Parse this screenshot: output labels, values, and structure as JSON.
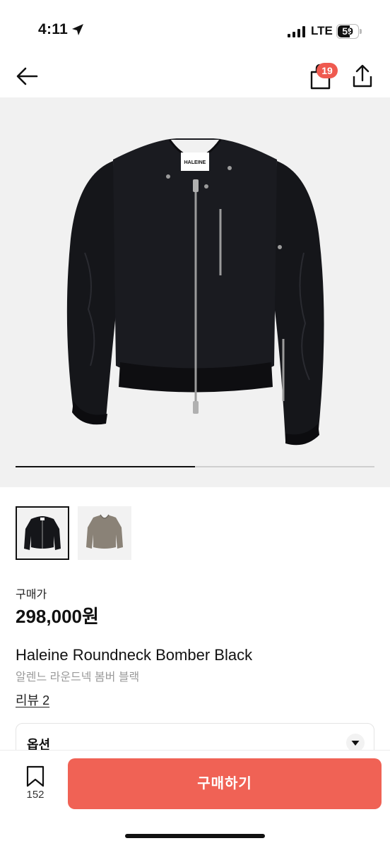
{
  "status_bar": {
    "time": "4:11",
    "network": "LTE",
    "battery": "59",
    "icons": [
      "location-arrow-icon",
      "signal-icon",
      "battery-icon"
    ]
  },
  "header": {
    "back_icon": "arrow-left-icon",
    "bag_icon": "shopping-bag-icon",
    "bag_badge": "19",
    "share_icon": "share-icon"
  },
  "gallery": {
    "images": [
      {
        "color": "black",
        "selected": true
      },
      {
        "color": "khaki",
        "selected": false
      }
    ],
    "progress": 0.5,
    "label_on_tag": "HALEINE"
  },
  "product": {
    "price_label": "구매가",
    "price": "298,000원",
    "name_en": "Haleine Roundneck Bomber Black",
    "name_ko": "알렌느 라운드넥 봄버 블랙",
    "review_link": "리뷰 2"
  },
  "options": {
    "label": "옵션",
    "chevron_icon": "chevron-down-icon"
  },
  "bottom_bar": {
    "bookmark_icon": "bookmark-icon",
    "bookmark_count": "152",
    "buy_label": "구매하기"
  },
  "colors": {
    "accent": "#f06255",
    "badge": "#ef5a50",
    "hero_bg": "#f1f1f1"
  }
}
